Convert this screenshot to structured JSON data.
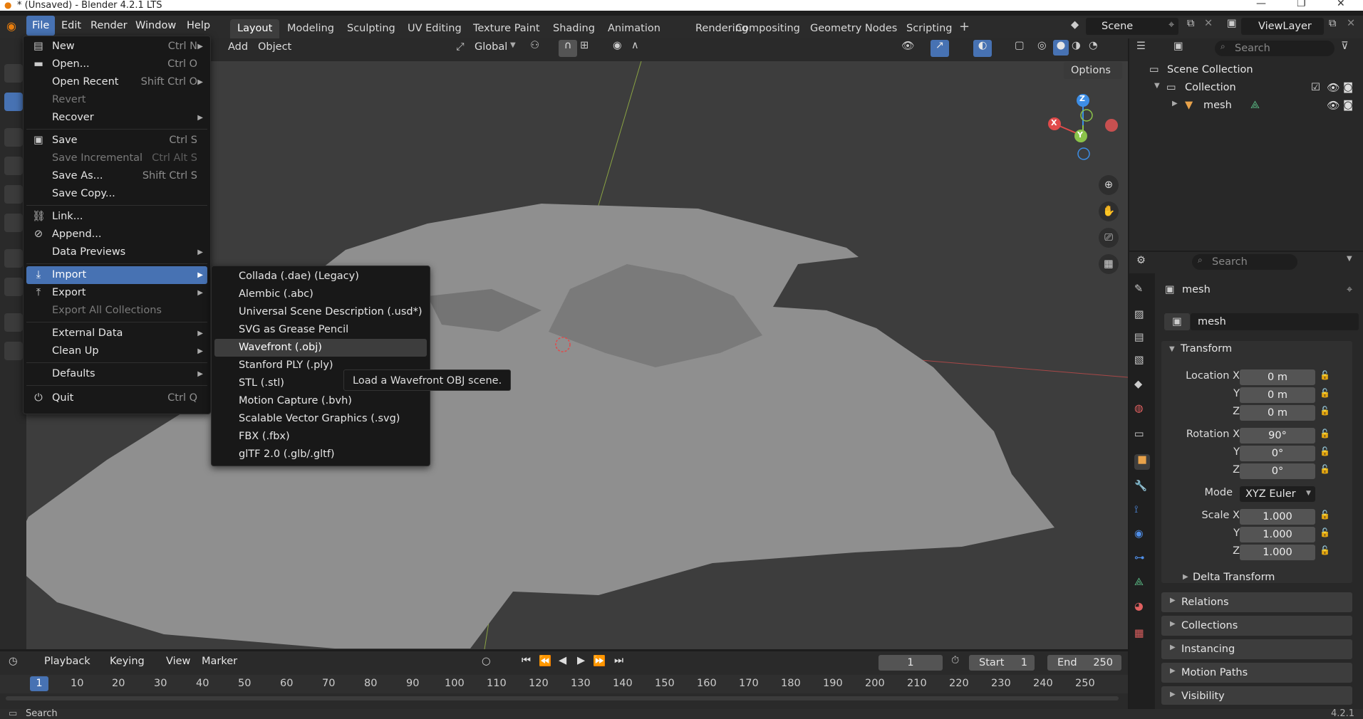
{
  "window": {
    "title": "* (Unsaved) - Blender 4.2.1 LTS"
  },
  "menubar": [
    "File",
    "Edit",
    "Render",
    "Window",
    "Help"
  ],
  "workspaces": [
    "Layout",
    "Modeling",
    "Sculpting",
    "UV Editing",
    "Texture Paint",
    "Shading",
    "Animation",
    "Rendering",
    "Compositing",
    "Geometry Nodes",
    "Scripting"
  ],
  "scene": {
    "name": "Scene",
    "view_layer": "ViewLayer"
  },
  "viewport_header": {
    "add": "Add",
    "object": "Object",
    "orientation": "Global",
    "options": "Options"
  },
  "file_menu": {
    "items": [
      {
        "label": "New",
        "shortcut": "Ctrl N",
        "submenu": true,
        "icon": "new-file-icon"
      },
      {
        "label": "Open...",
        "shortcut": "Ctrl O",
        "icon": "folder-icon"
      },
      {
        "label": "Open Recent",
        "shortcut": "Shift Ctrl O",
        "submenu": true
      },
      {
        "label": "Revert",
        "disabled": true
      },
      {
        "label": "Recover",
        "submenu": true
      },
      {
        "label": "Save",
        "shortcut": "Ctrl S",
        "icon": "save-icon"
      },
      {
        "label": "Save Incremental",
        "shortcut": "Ctrl Alt S",
        "disabled": true
      },
      {
        "label": "Save As...",
        "shortcut": "Shift Ctrl S"
      },
      {
        "label": "Save Copy..."
      },
      {
        "label": "Link...",
        "icon": "link-icon"
      },
      {
        "label": "Append...",
        "icon": "append-icon"
      },
      {
        "label": "Data Previews",
        "submenu": true
      },
      {
        "label": "Import",
        "submenu": true,
        "highlighted": true,
        "icon": "import-icon"
      },
      {
        "label": "Export",
        "submenu": true,
        "icon": "export-icon"
      },
      {
        "label": "Export All Collections",
        "disabled": true
      },
      {
        "label": "External Data",
        "submenu": true
      },
      {
        "label": "Clean Up",
        "submenu": true
      },
      {
        "label": "Defaults",
        "submenu": true
      },
      {
        "label": "Quit",
        "shortcut": "Ctrl Q",
        "icon": "power-icon"
      }
    ]
  },
  "import_submenu": {
    "items": [
      "Collada (.dae) (Legacy)",
      "Alembic (.abc)",
      "Universal Scene Description (.usd*)",
      "SVG as Grease Pencil",
      "Wavefront (.obj)",
      "Stanford PLY (.ply)",
      "STL (.stl)",
      "Motion Capture (.bvh)",
      "Scalable Vector Graphics (.svg)",
      "FBX (.fbx)",
      "glTF 2.0 (.glb/.gltf)"
    ],
    "highlighted": "Wavefront (.obj)",
    "tooltip": "Load a Wavefront OBJ scene."
  },
  "gizmo": {
    "x": "X",
    "y": "Y",
    "z": "Z"
  },
  "outliner": {
    "search_placeholder": "Search",
    "scene_collection": "Scene Collection",
    "collection": "Collection",
    "object": "mesh"
  },
  "properties": {
    "search_placeholder": "Search",
    "object_name": "mesh",
    "data_name": "mesh",
    "transform_label": "Transform",
    "location_label": "Location X",
    "location": [
      "0 m",
      "0 m",
      "0 m"
    ],
    "rotation_label": "Rotation X",
    "rotation": [
      "90°",
      "0°",
      "0°"
    ],
    "mode_label": "Mode",
    "mode": "XYZ Euler",
    "scale_label": "Scale X",
    "scale": [
      "1.000",
      "1.000",
      "1.000"
    ],
    "axis_y": "Y",
    "axis_z": "Z",
    "delta_transform": "Delta Transform",
    "panels": [
      "Relations",
      "Collections",
      "Instancing",
      "Motion Paths",
      "Visibility"
    ]
  },
  "timeline": {
    "playback": "Playback",
    "keying": "Keying",
    "view": "View",
    "marker": "Marker",
    "current_frame": "1",
    "start_label": "Start",
    "start": "1",
    "end_label": "End",
    "end": "250",
    "ticks": [
      "1",
      "10",
      "20",
      "30",
      "40",
      "50",
      "60",
      "70",
      "80",
      "90",
      "100",
      "110",
      "120",
      "130",
      "140",
      "150",
      "160",
      "170",
      "180",
      "190",
      "200",
      "210",
      "220",
      "230",
      "240",
      "250"
    ]
  },
  "statusbar": {
    "left": "Search",
    "version": "4.2.1"
  },
  "colors": {
    "accent": "#4772b3",
    "x_axis": "#e04a4a",
    "y_axis": "#8bc34a",
    "z_axis": "#3d8ee6",
    "header": "#2b2b2b"
  }
}
